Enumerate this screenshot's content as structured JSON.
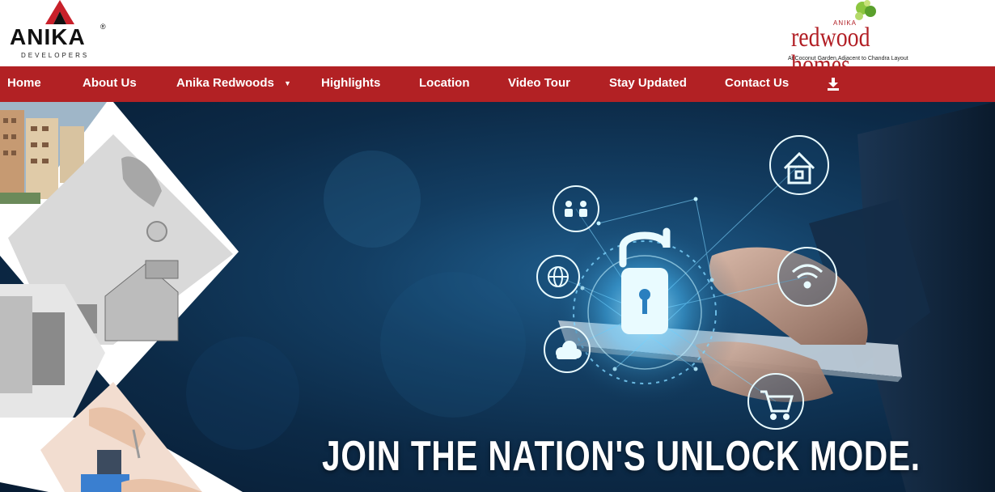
{
  "brand_left": {
    "name": "ANIKA",
    "registered": "®",
    "subtitle": "DEVELOPERS"
  },
  "brand_right": {
    "small": "ANIKA",
    "name": "redwood homes",
    "tagline": "At Coconut Garden,Adjacent to Chandra Layout"
  },
  "nav": {
    "items": [
      {
        "label": "Home"
      },
      {
        "label": "About Us"
      },
      {
        "label": "Anika Redwoods",
        "caret": "▼"
      },
      {
        "label": "Highlights"
      },
      {
        "label": "Location"
      },
      {
        "label": "Video Tour"
      },
      {
        "label": "Stay Updated"
      },
      {
        "label": "Contact Us"
      }
    ],
    "download_icon": "download-icon"
  },
  "hero": {
    "headline": "JOIN THE NATION'S UNLOCK MODE."
  },
  "colors": {
    "nav_bg": "#b22124",
    "brand_red": "#b21e24",
    "hero_dark": "#0c2a47",
    "glow": "#7fd6ff"
  }
}
